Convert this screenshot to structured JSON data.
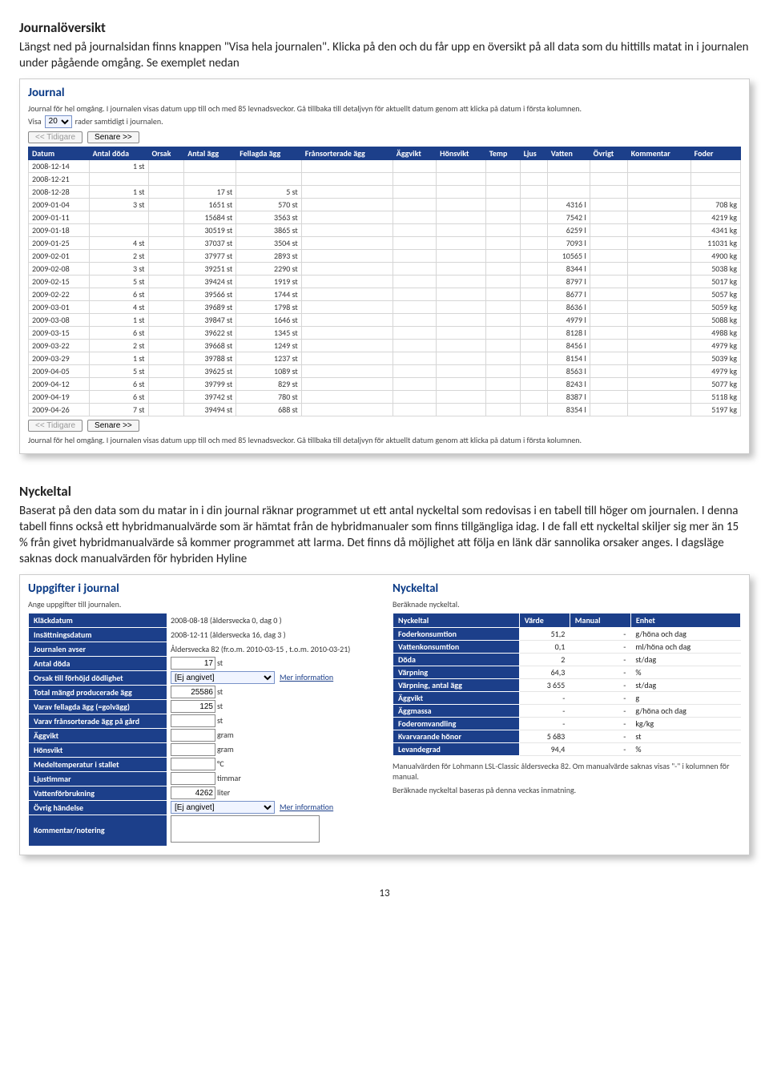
{
  "section1": {
    "heading": "Journalöversikt",
    "para": "Längst ned på journalsidan finns knappen \"Visa hela journalen\". Klicka på den och du får upp en översikt på all data som du hittills matat in i journalen under pågående omgång. Se exemplet nedan"
  },
  "journalPanel": {
    "title": "Journal",
    "intro": "Journal för hel omgång. I journalen visas datum upp till och med 85 levnadsveckor. Gå tillbaka till detaljvyn för aktuellt datum genom att klicka på datum i första kolumnen.",
    "visaPrefix": "Visa",
    "visaValue": "20",
    "visaSuffix": "rader samtidigt i journalen.",
    "btnPrev": "<< Tidigare",
    "btnNext": "Senare >>",
    "columns": [
      "Datum",
      "Antal döda",
      "Orsak",
      "Antal ägg",
      "Fellagda ägg",
      "Frånsorterade ägg",
      "Äggvikt",
      "Hönsvikt",
      "Temp",
      "Ljus",
      "Vatten",
      "Övrigt",
      "Kommentar",
      "Foder"
    ],
    "rows": [
      {
        "datum": "2008-12-14",
        "doda": "1 st",
        "agg": "",
        "fell": "",
        "vatten": "",
        "foder": ""
      },
      {
        "datum": "2008-12-21",
        "doda": "",
        "agg": "",
        "fell": "",
        "vatten": "",
        "foder": ""
      },
      {
        "datum": "2008-12-28",
        "doda": "1 st",
        "agg": "17 st",
        "fell": "5 st",
        "vatten": "",
        "foder": ""
      },
      {
        "datum": "2009-01-04",
        "doda": "3 st",
        "agg": "1651 st",
        "fell": "570 st",
        "vatten": "4316 l",
        "foder": "708 kg"
      },
      {
        "datum": "2009-01-11",
        "doda": "",
        "agg": "15684 st",
        "fell": "3563 st",
        "vatten": "7542 l",
        "foder": "4219 kg"
      },
      {
        "datum": "2009-01-18",
        "doda": "",
        "agg": "30519 st",
        "fell": "3865 st",
        "vatten": "6259 l",
        "foder": "4341 kg"
      },
      {
        "datum": "2009-01-25",
        "doda": "4 st",
        "agg": "37037 st",
        "fell": "3504 st",
        "vatten": "7093 l",
        "foder": "11031 kg"
      },
      {
        "datum": "2009-02-01",
        "doda": "2 st",
        "agg": "37977 st",
        "fell": "2893 st",
        "vatten": "10565 l",
        "foder": "4900 kg"
      },
      {
        "datum": "2009-02-08",
        "doda": "3 st",
        "agg": "39251 st",
        "fell": "2290 st",
        "vatten": "8344 l",
        "foder": "5038 kg"
      },
      {
        "datum": "2009-02-15",
        "doda": "5 st",
        "agg": "39424 st",
        "fell": "1919 st",
        "vatten": "8797 l",
        "foder": "5017 kg"
      },
      {
        "datum": "2009-02-22",
        "doda": "6 st",
        "agg": "39566 st",
        "fell": "1744 st",
        "vatten": "8677 l",
        "foder": "5057 kg"
      },
      {
        "datum": "2009-03-01",
        "doda": "4 st",
        "agg": "39689 st",
        "fell": "1798 st",
        "vatten": "8636 l",
        "foder": "5059 kg"
      },
      {
        "datum": "2009-03-08",
        "doda": "1 st",
        "agg": "39847 st",
        "fell": "1646 st",
        "vatten": "4979 l",
        "foder": "5088 kg"
      },
      {
        "datum": "2009-03-15",
        "doda": "6 st",
        "agg": "39622 st",
        "fell": "1345 st",
        "vatten": "8128 l",
        "foder": "4988 kg"
      },
      {
        "datum": "2009-03-22",
        "doda": "2 st",
        "agg": "39668 st",
        "fell": "1249 st",
        "vatten": "8456 l",
        "foder": "4979 kg"
      },
      {
        "datum": "2009-03-29",
        "doda": "1 st",
        "agg": "39788 st",
        "fell": "1237 st",
        "vatten": "8154 l",
        "foder": "5039 kg"
      },
      {
        "datum": "2009-04-05",
        "doda": "5 st",
        "agg": "39625 st",
        "fell": "1089 st",
        "vatten": "8563 l",
        "foder": "4979 kg"
      },
      {
        "datum": "2009-04-12",
        "doda": "6 st",
        "agg": "39799 st",
        "fell": "829 st",
        "vatten": "8243 l",
        "foder": "5077 kg"
      },
      {
        "datum": "2009-04-19",
        "doda": "6 st",
        "agg": "39742 st",
        "fell": "780 st",
        "vatten": "8387 l",
        "foder": "5118 kg"
      },
      {
        "datum": "2009-04-26",
        "doda": "7 st",
        "agg": "39494 st",
        "fell": "688 st",
        "vatten": "8354 l",
        "foder": "5197 kg"
      }
    ],
    "outro": "Journal för hel omgång. I journalen visas datum upp till och med 85 levnadsveckor. Gå tillbaka till detaljvyn för aktuellt datum genom att klicka på datum i första kolumnen."
  },
  "section2": {
    "heading": "Nyckeltal",
    "para": "Baserat på den data som du matar in i din journal räknar programmet ut ett antal nyckeltal som redovisas i en tabell till höger om journalen.  I denna tabell finns också ett hybridmanualvärde som är hämtat från de hybridmanualer som finns tillgängliga idag. I de fall ett nyckeltal skiljer sig mer än 15 % från givet hybridmanualvärde så kommer programmet att larma. Det finns då möjlighet att följa en länk där sannolika orsaker anges.  I dagsläge saknas dock manualvärden för hybriden Hyline"
  },
  "formPanel": {
    "title": "Uppgifter i journal",
    "sub": "Ange uppgifter till journalen.",
    "rows": [
      {
        "label": "Kläckdatum",
        "value": "2008-08-18 (åldersvecka 0, dag 0 )",
        "type": "text"
      },
      {
        "label": "Insättningsdatum",
        "value": "2008-12-11 (åldersvecka 16, dag 3 )",
        "type": "text"
      },
      {
        "label": "Journalen avser",
        "value": "Åldersvecka 82 (fr.o.m. 2010-03-15 , t.o.m. 2010-03-21)",
        "type": "text"
      },
      {
        "label": "Antal döda",
        "value": "17",
        "unit": "st",
        "type": "input"
      },
      {
        "label": "Orsak till förhöjd dödlighet",
        "value": "[Ej angivet]",
        "type": "select",
        "link": "Mer information"
      },
      {
        "label": "Total mängd producerade ägg",
        "value": "25586",
        "unit": "st",
        "type": "input"
      },
      {
        "label": "Varav fellagda ägg (=golvägg)",
        "value": "125",
        "unit": "st",
        "type": "input"
      },
      {
        "label": "Varav frånsorterade ägg på gård",
        "value": "",
        "unit": "st",
        "type": "input"
      },
      {
        "label": "Äggvikt",
        "value": "",
        "unit": "gram",
        "type": "input"
      },
      {
        "label": "Hönsvikt",
        "value": "",
        "unit": "gram",
        "type": "input"
      },
      {
        "label": "Medeltemperatur i stallet",
        "value": "",
        "unit": "°C",
        "type": "input"
      },
      {
        "label": "Ljustimmar",
        "value": "",
        "unit": "timmar",
        "type": "input"
      },
      {
        "label": "Vattenförbrukning",
        "value": "4262",
        "unit": "liter",
        "type": "input"
      },
      {
        "label": "Övrig händelse",
        "value": "[Ej angivet]",
        "type": "select",
        "link": "Mer information"
      },
      {
        "label": "Kommentar/notering",
        "value": "",
        "type": "textarea"
      }
    ]
  },
  "nycPanel": {
    "title": "Nyckeltal",
    "sub": "Beräknade nyckeltal.",
    "headers": [
      "Nyckeltal",
      "Värde",
      "Manual",
      "Enhet"
    ],
    "rows": [
      {
        "k": "Foderkonsumtion",
        "v": "51,2",
        "m": "-",
        "u": "g/höna och dag"
      },
      {
        "k": "Vattenkonsumtion",
        "v": "0,1",
        "m": "-",
        "u": "ml/höna och dag"
      },
      {
        "k": "Döda",
        "v": "2",
        "m": "-",
        "u": "st/dag"
      },
      {
        "k": "Värpning",
        "v": "64,3",
        "m": "-",
        "u": "%"
      },
      {
        "k": "Värpning, antal ägg",
        "v": "3 655",
        "m": "-",
        "u": "st/dag"
      },
      {
        "k": "Äggvikt",
        "v": "-",
        "m": "-",
        "u": "g"
      },
      {
        "k": "Äggmassa",
        "v": "-",
        "m": "-",
        "u": "g/höna och dag"
      },
      {
        "k": "Foderomvandling",
        "v": "-",
        "m": "-",
        "u": "kg/kg"
      },
      {
        "k": "Kvarvarande hönor",
        "v": "5 683",
        "m": "-",
        "u": "st"
      },
      {
        "k": "Levandegrad",
        "v": "94,4",
        "m": "-",
        "u": "%"
      }
    ],
    "note1": "Manualvärden för Lohmann LSL-Classic åldersvecka 82. Om manualvärde saknas visas \"-\" i kolumnen för manual.",
    "note2": "Beräknade nyckeltal baseras på denna veckas inmatning."
  },
  "pageNumber": "13"
}
